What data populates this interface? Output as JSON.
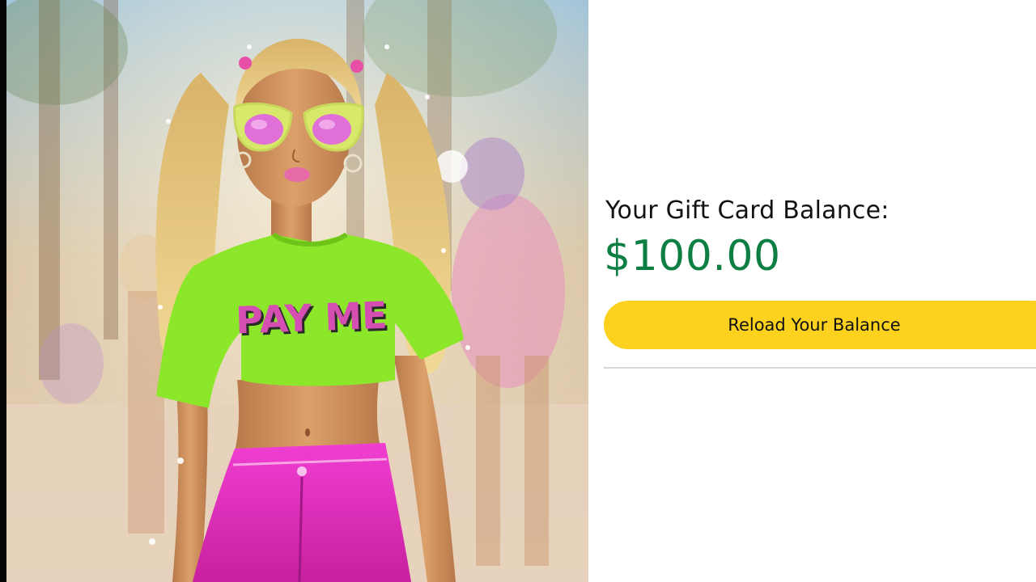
{
  "photo": {
    "shirt_text": "PAY ME",
    "colors": {
      "shirt": "#8ce62a",
      "shorts": "#e82fc8",
      "hair": "#e8c77a",
      "skin": "#d4935e",
      "lenses": "#e070d8"
    }
  },
  "gift_card": {
    "label": "Your Gift Card Balance:",
    "amount": "$100.00",
    "reload_button": "Reload Your Balance"
  },
  "theme": {
    "amount_color": "#0d7f43",
    "button_color": "#fcd21e"
  }
}
